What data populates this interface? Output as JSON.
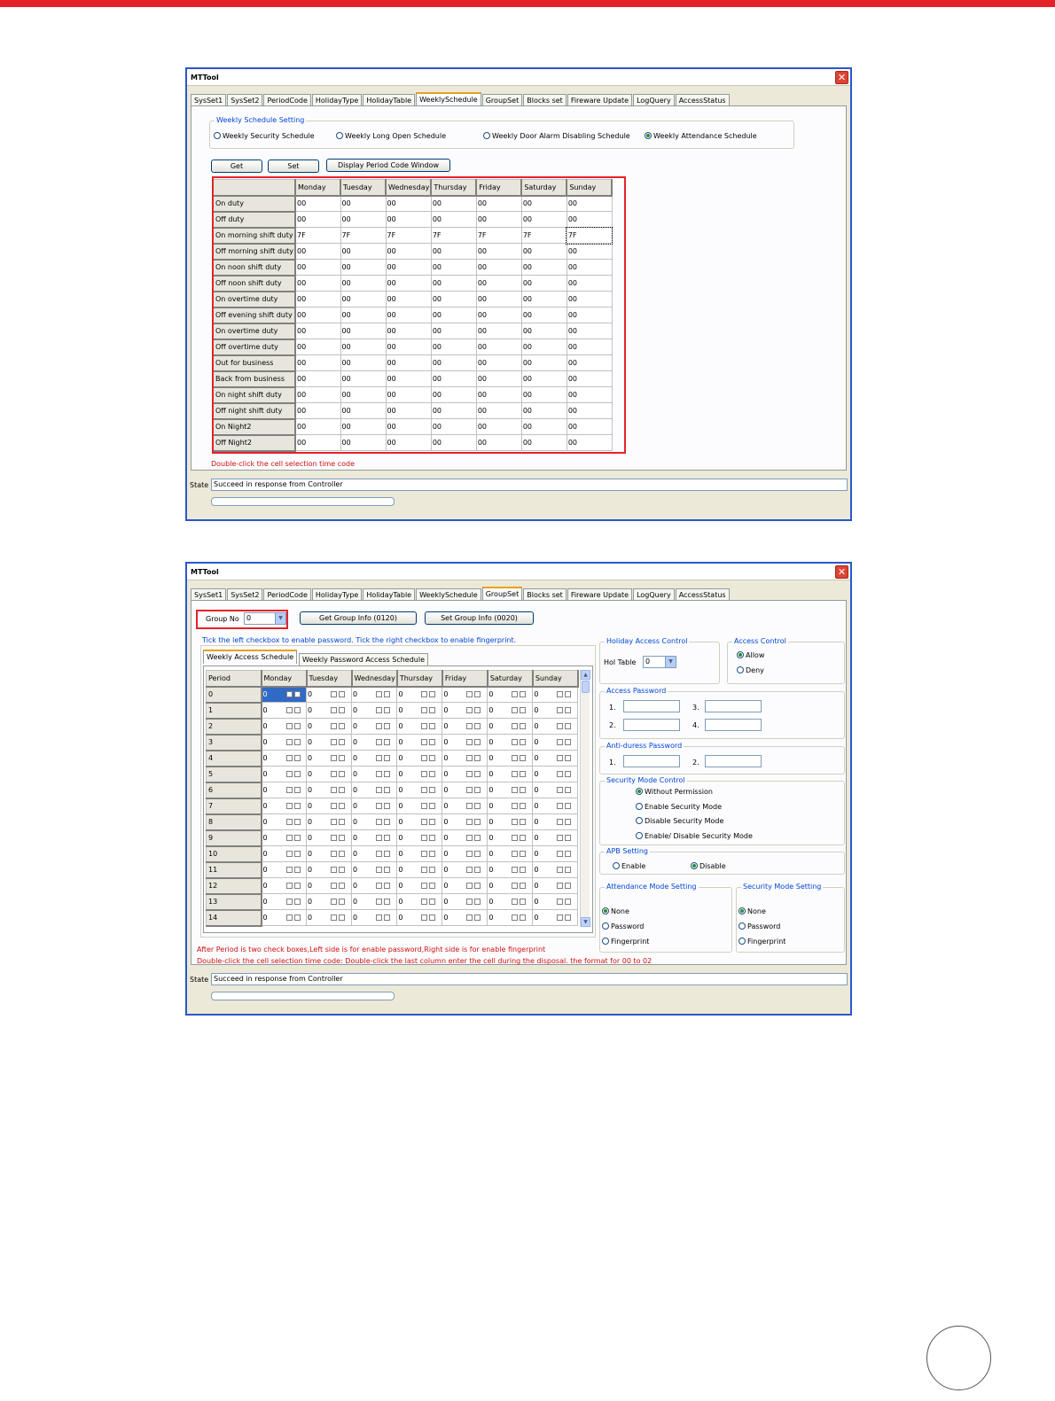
{
  "window_title": "MTTool",
  "tabs": [
    "SysSet1",
    "SysSet2",
    "PeriodCode",
    "HolidayType",
    "HolidayTable",
    "WeeklySchedule",
    "GroupSet",
    "Blocks set",
    "Fireware Update",
    "LogQuery",
    "AccessStatus"
  ],
  "window1": {
    "active_tab": "WeeklySchedule",
    "schedule_group_label": "Weekly Schedule Setting",
    "radios": [
      {
        "label": "Weekly Security Schedule",
        "checked": false
      },
      {
        "label": "Weekly Long Open Schedule",
        "checked": false
      },
      {
        "label": "Weekly Door Alarm Disabling Schedule",
        "checked": false
      },
      {
        "label": "Weekly Attendance Schedule",
        "checked": true
      }
    ],
    "get_button": "Get",
    "set_button": "Set",
    "display_button": "Display Period Code Window",
    "days": [
      "Monday",
      "Tuesday",
      "Wednesday",
      "Thursday",
      "Friday",
      "Saturday",
      "Sunday"
    ],
    "rows": [
      {
        "label": "On duty",
        "values": [
          "00",
          "00",
          "00",
          "00",
          "00",
          "00",
          "00"
        ]
      },
      {
        "label": "Off duty",
        "values": [
          "00",
          "00",
          "00",
          "00",
          "00",
          "00",
          "00"
        ]
      },
      {
        "label": "On morning shift duty",
        "values": [
          "7F",
          "7F",
          "7F",
          "7F",
          "7F",
          "7F",
          "7F"
        ]
      },
      {
        "label": "Off morning shift duty",
        "values": [
          "00",
          "00",
          "00",
          "00",
          "00",
          "00",
          "00"
        ]
      },
      {
        "label": "On noon shift duty",
        "values": [
          "00",
          "00",
          "00",
          "00",
          "00",
          "00",
          "00"
        ]
      },
      {
        "label": "Off noon shift duty",
        "values": [
          "00",
          "00",
          "00",
          "00",
          "00",
          "00",
          "00"
        ]
      },
      {
        "label": "On overtime duty",
        "values": [
          "00",
          "00",
          "00",
          "00",
          "00",
          "00",
          "00"
        ]
      },
      {
        "label": "Off evening shift duty",
        "values": [
          "00",
          "00",
          "00",
          "00",
          "00",
          "00",
          "00"
        ]
      },
      {
        "label": "On overtime duty",
        "values": [
          "00",
          "00",
          "00",
          "00",
          "00",
          "00",
          "00"
        ]
      },
      {
        "label": "Off overtime duty",
        "values": [
          "00",
          "00",
          "00",
          "00",
          "00",
          "00",
          "00"
        ]
      },
      {
        "label": "Out for business",
        "values": [
          "00",
          "00",
          "00",
          "00",
          "00",
          "00",
          "00"
        ]
      },
      {
        "label": "Back from business",
        "values": [
          "00",
          "00",
          "00",
          "00",
          "00",
          "00",
          "00"
        ]
      },
      {
        "label": "On night shift duty",
        "values": [
          "00",
          "00",
          "00",
          "00",
          "00",
          "00",
          "00"
        ]
      },
      {
        "label": "Off night shift duty",
        "values": [
          "00",
          "00",
          "00",
          "00",
          "00",
          "00",
          "00"
        ]
      },
      {
        "label": "On Night2",
        "values": [
          "00",
          "00",
          "00",
          "00",
          "00",
          "00",
          "00"
        ]
      },
      {
        "label": "Off Night2",
        "values": [
          "00",
          "00",
          "00",
          "00",
          "00",
          "00",
          "00"
        ]
      }
    ],
    "hint": "Double-click the cell selection time code",
    "state_label": "State",
    "state_text": "Succeed in response from Controller"
  },
  "window2": {
    "active_tab": "GroupSet",
    "group_no_label": "Group No",
    "group_no_value": "0",
    "get_group_button": "Get Group Info (0120)",
    "set_group_button": "Set Group Info (0020)",
    "checkbox_hint": "Tick the left checkbox to enable password. Tick the right checkbox to enable fingerprint.",
    "subtabs": [
      "Weekly Access Schedule",
      "Weekly Password Access Schedule"
    ],
    "period_header": "Period",
    "days": [
      "Monday",
      "Tuesday",
      "Wednesday",
      "Thursday",
      "Friday",
      "Saturday",
      "Sunday"
    ],
    "periods": [
      "0",
      "1",
      "2",
      "3",
      "4",
      "5",
      "6",
      "7",
      "8",
      "9",
      "10",
      "11",
      "12",
      "13",
      "14"
    ],
    "cell_value": "0",
    "holiday_group": "Holiday Access Control",
    "hol_table_label": "Hol Table",
    "hol_table_value": "0",
    "access_control_group": "Access Control",
    "access_allow": "Allow",
    "access_deny": "Deny",
    "access_password_group": "Access Password",
    "pw_labels": [
      "1.",
      "2.",
      "3.",
      "4."
    ],
    "antiduress_group": "Anti-duress Password",
    "ad_labels": [
      "1.",
      "2."
    ],
    "security_mode_group": "Security Mode Control",
    "security_options": [
      "Without Permission",
      "Enable Security Mode",
      "Disable Security Mode",
      "Enable/ Disable Security Mode"
    ],
    "apb_group": "APB Setting",
    "apb_enable": "Enable",
    "apb_disable": "Disable",
    "attendance_group": "Attendance Mode Setting",
    "attendance_options": [
      "None",
      "Password",
      "Fingerprint"
    ],
    "security_setting_group": "Security Mode Setting",
    "security_setting_options": [
      "None",
      "Password",
      "Fingerprint"
    ],
    "note1": "After Period is two check boxes,Left side is for enable password,Right side is for enable fingerprint",
    "note2": "Double-click the cell selection time code: Double-click the last column enter the cell during the disposal. the format for 00 to 02",
    "state_label": "State",
    "state_text": "Succeed in response from Controller"
  },
  "colors": {
    "accent_red": "#e52228",
    "title_blue": "#0046d5",
    "window_border": "#2a57c9"
  }
}
